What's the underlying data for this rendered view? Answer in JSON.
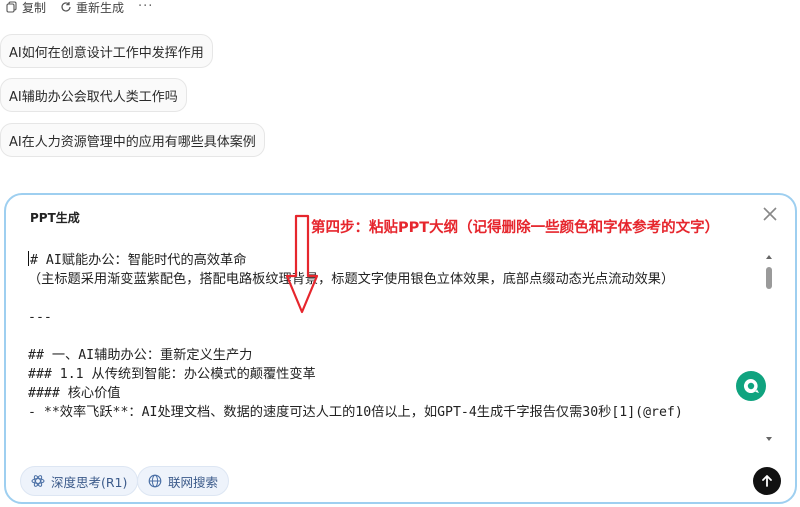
{
  "actions": {
    "copy": "复制",
    "regenerate": "重新生成",
    "more": "···"
  },
  "suggestions": [
    "AI如何在创意设计工作中发挥作用",
    "AI辅助办公会取代人类工作吗",
    "AI在人力资源管理中的应用有哪些具体案例"
  ],
  "panel": {
    "title": "PPT生成",
    "lines": [
      "# AI赋能办公：智能时代的高效革命",
      "（主标题采用渐变蓝紫配色，搭配电路板纹理背景，标题文字使用银色立体效果，底部点缀动态光点流动效果）",
      "",
      "---",
      "",
      "## 一、AI辅助办公：重新定义生产力",
      "### 1.1 从传统到智能：办公模式的颠覆性变革",
      "#### 核心价值",
      "- **效率飞跃**：AI处理文档、数据的速度可达人工的10倍以上，如GPT-4生成千字报告仅需30秒[1](@ref)"
    ],
    "chips": {
      "deep_think": "深度思考(R1)",
      "web_search": "联网搜索"
    }
  },
  "annotation": {
    "text": "第四步：粘贴PPT大纲（记得删除一些颜色和字体参考的文字）",
    "color": "#e6262d"
  }
}
